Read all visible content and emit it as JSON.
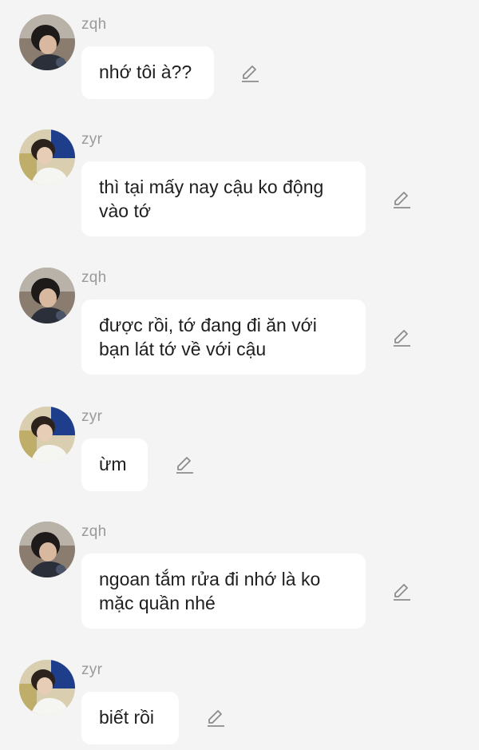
{
  "messages": [
    {
      "sender": "zqh",
      "avatar_icon": "avatar-zqh-icon",
      "text": "nhớ tôi à??"
    },
    {
      "sender": "zyr",
      "avatar_icon": "avatar-zyr-icon",
      "text": "thì tại mấy nay cậu ko động vào tớ"
    },
    {
      "sender": "zqh",
      "avatar_icon": "avatar-zqh-icon",
      "text": "được rồi, tớ đang đi ăn với bạn lát tớ về với cậu"
    },
    {
      "sender": "zyr",
      "avatar_icon": "avatar-zyr-icon",
      "text": "ừm"
    },
    {
      "sender": "zqh",
      "avatar_icon": "avatar-zqh-icon",
      "text": "ngoan tắm rửa đi nhớ là ko mặc quần nhé"
    },
    {
      "sender": "zyr",
      "avatar_icon": "avatar-zyr-icon",
      "text": "biết rồi"
    }
  ],
  "edit_icon": "pencil-edit-icon",
  "colors": {
    "background": "#f4f4f4",
    "bubble": "#ffffff",
    "sender_name": "#9a9a9a",
    "text": "#1e1e1e"
  }
}
